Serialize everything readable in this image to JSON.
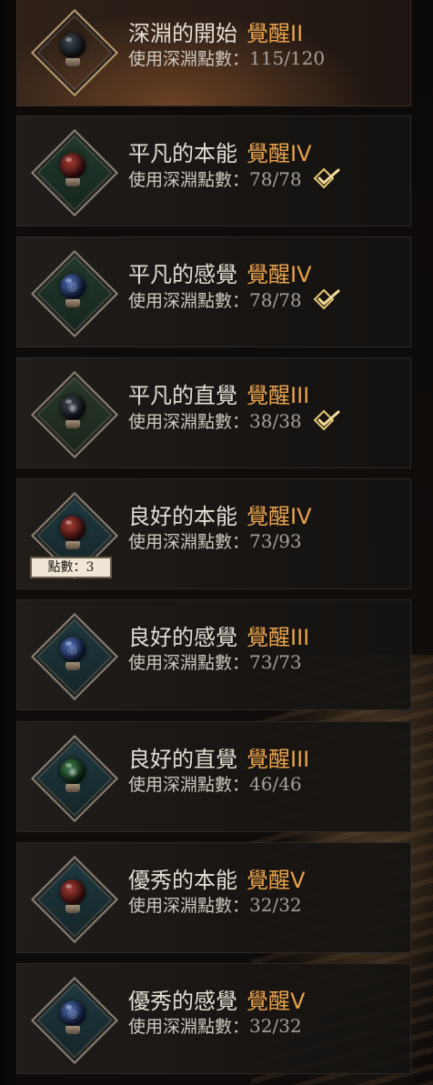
{
  "skills": [
    {
      "name": "深淵的開始",
      "awakening": "覺醒II",
      "usage_label": "使用深淵點數：",
      "usage_value": "115/120",
      "completed": false,
      "orb_color": "#2a2f38",
      "orb_icon": "dark-orb-icon"
    },
    {
      "name": "平凡的本能",
      "awakening": "覺醒IV",
      "usage_label": "使用深淵點數：",
      "usage_value": "78/78",
      "completed": true,
      "orb_color": "#7a2420",
      "orb_icon": "red-orb-icon"
    },
    {
      "name": "平凡的感覺",
      "awakening": "覺醒IV",
      "usage_label": "使用深淵點數：",
      "usage_value": "78/78",
      "completed": true,
      "orb_color": "#2f3f6b",
      "orb_icon": "swirl-orb-icon"
    },
    {
      "name": "平凡的直覺",
      "awakening": "覺醒III",
      "usage_label": "使用深淵點數：",
      "usage_value": "38/38",
      "completed": true,
      "orb_color": "#2a3a2e",
      "orb_icon": "eye-orb-icon"
    },
    {
      "name": "良好的本能",
      "awakening": "覺醒IV",
      "usage_label": "使用深淵點數：",
      "usage_value": "73/93",
      "completed": false,
      "orb_color": "#7a2420",
      "orb_icon": "red-orb-icon",
      "points_badge": {
        "label": "點數：",
        "value": "3"
      }
    },
    {
      "name": "良好的感覺",
      "awakening": "覺醒III",
      "usage_label": "使用深淵點數：",
      "usage_value": "73/73",
      "completed": false,
      "orb_color": "#2f3f6b",
      "orb_icon": "swirl-orb-icon"
    },
    {
      "name": "良好的直覺",
      "awakening": "覺醒III",
      "usage_label": "使用深淵點數：",
      "usage_value": "46/46",
      "completed": false,
      "orb_color": "#2a5a36",
      "orb_icon": "eye-orb-icon"
    },
    {
      "name": "優秀的本能",
      "awakening": "覺醒V",
      "usage_label": "使用深淵點數：",
      "usage_value": "32/32",
      "completed": false,
      "orb_color": "#7a2420",
      "orb_icon": "red-orb-icon"
    },
    {
      "name": "優秀的感覺",
      "awakening": "覺醒V",
      "usage_label": "使用深淵點數：",
      "usage_value": "32/32",
      "completed": false,
      "orb_color": "#2f3f6b",
      "orb_icon": "swirl-orb-icon"
    }
  ],
  "colors": {
    "awakening_accent": "#e8a24c",
    "name_text": "#e4ddd3",
    "usage_text": "#cfc8be",
    "check_gold": "#e8c872"
  }
}
